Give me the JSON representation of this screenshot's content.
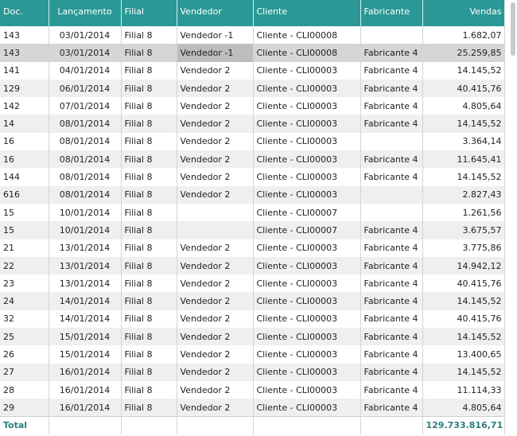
{
  "columns": {
    "doc": "Doc.",
    "lancamento": "Lançamento",
    "filial": "Filial",
    "vendedor": "Vendedor",
    "cliente": "Cliente",
    "fabricante": "Fabricante",
    "vendas": "Vendas"
  },
  "rows": [
    {
      "doc": "143",
      "lancamento": "03/01/2014",
      "filial": "Filial 8",
      "vendedor": "Vendedor -1",
      "cliente": "Cliente - CLI00008",
      "fabricante": "",
      "vendas": "1.682,07"
    },
    {
      "doc": "143",
      "lancamento": "03/01/2014",
      "filial": "Filial 8",
      "vendedor": "Vendedor -1",
      "cliente": "Cliente - CLI00008",
      "fabricante": "Fabricante 4",
      "vendas": "25.259,85"
    },
    {
      "doc": "141",
      "lancamento": "04/01/2014",
      "filial": "Filial 8",
      "vendedor": "Vendedor 2",
      "cliente": "Cliente - CLI00003",
      "fabricante": "Fabricante 4",
      "vendas": "14.145,52"
    },
    {
      "doc": "129",
      "lancamento": "06/01/2014",
      "filial": "Filial 8",
      "vendedor": "Vendedor 2",
      "cliente": "Cliente - CLI00003",
      "fabricante": "Fabricante 4",
      "vendas": "40.415,76"
    },
    {
      "doc": "142",
      "lancamento": "07/01/2014",
      "filial": "Filial 8",
      "vendedor": "Vendedor 2",
      "cliente": "Cliente - CLI00003",
      "fabricante": "Fabricante 4",
      "vendas": "4.805,64"
    },
    {
      "doc": "14",
      "lancamento": "08/01/2014",
      "filial": "Filial 8",
      "vendedor": "Vendedor 2",
      "cliente": "Cliente - CLI00003",
      "fabricante": "Fabricante 4",
      "vendas": "14.145,52"
    },
    {
      "doc": "16",
      "lancamento": "08/01/2014",
      "filial": "Filial 8",
      "vendedor": "Vendedor 2",
      "cliente": "Cliente - CLI00003",
      "fabricante": "",
      "vendas": "3.364,14"
    },
    {
      "doc": "16",
      "lancamento": "08/01/2014",
      "filial": "Filial 8",
      "vendedor": "Vendedor 2",
      "cliente": "Cliente - CLI00003",
      "fabricante": "Fabricante 4",
      "vendas": "11.645,41"
    },
    {
      "doc": "144",
      "lancamento": "08/01/2014",
      "filial": "Filial 8",
      "vendedor": "Vendedor 2",
      "cliente": "Cliente - CLI00003",
      "fabricante": "Fabricante 4",
      "vendas": "14.145,52"
    },
    {
      "doc": "616",
      "lancamento": "08/01/2014",
      "filial": "Filial 8",
      "vendedor": "Vendedor 2",
      "cliente": "Cliente - CLI00003",
      "fabricante": "",
      "vendas": "2.827,43"
    },
    {
      "doc": "15",
      "lancamento": "10/01/2014",
      "filial": "Filial 8",
      "vendedor": "",
      "cliente": "Cliente - CLI00007",
      "fabricante": "",
      "vendas": "1.261,56"
    },
    {
      "doc": "15",
      "lancamento": "10/01/2014",
      "filial": "Filial 8",
      "vendedor": "",
      "cliente": "Cliente - CLI00007",
      "fabricante": "Fabricante 4",
      "vendas": "3.675,57"
    },
    {
      "doc": "21",
      "lancamento": "13/01/2014",
      "filial": "Filial 8",
      "vendedor": "Vendedor 2",
      "cliente": "Cliente - CLI00003",
      "fabricante": "Fabricante 4",
      "vendas": "3.775,86"
    },
    {
      "doc": "22",
      "lancamento": "13/01/2014",
      "filial": "Filial 8",
      "vendedor": "Vendedor 2",
      "cliente": "Cliente - CLI00003",
      "fabricante": "Fabricante 4",
      "vendas": "14.942,12"
    },
    {
      "doc": "23",
      "lancamento": "13/01/2014",
      "filial": "Filial 8",
      "vendedor": "Vendedor 2",
      "cliente": "Cliente - CLI00003",
      "fabricante": "Fabricante 4",
      "vendas": "40.415,76"
    },
    {
      "doc": "24",
      "lancamento": "14/01/2014",
      "filial": "Filial 8",
      "vendedor": "Vendedor 2",
      "cliente": "Cliente - CLI00003",
      "fabricante": "Fabricante 4",
      "vendas": "14.145,52"
    },
    {
      "doc": "32",
      "lancamento": "14/01/2014",
      "filial": "Filial 8",
      "vendedor": "Vendedor 2",
      "cliente": "Cliente - CLI00003",
      "fabricante": "Fabricante 4",
      "vendas": "40.415,76"
    },
    {
      "doc": "25",
      "lancamento": "15/01/2014",
      "filial": "Filial 8",
      "vendedor": "Vendedor 2",
      "cliente": "Cliente - CLI00003",
      "fabricante": "Fabricante 4",
      "vendas": "14.145,52"
    },
    {
      "doc": "26",
      "lancamento": "15/01/2014",
      "filial": "Filial 8",
      "vendedor": "Vendedor 2",
      "cliente": "Cliente - CLI00003",
      "fabricante": "Fabricante 4",
      "vendas": "13.400,65"
    },
    {
      "doc": "27",
      "lancamento": "16/01/2014",
      "filial": "Filial 8",
      "vendedor": "Vendedor 2",
      "cliente": "Cliente - CLI00003",
      "fabricante": "Fabricante 4",
      "vendas": "14.145,52"
    },
    {
      "doc": "28",
      "lancamento": "16/01/2014",
      "filial": "Filial 8",
      "vendedor": "Vendedor 2",
      "cliente": "Cliente - CLI00003",
      "fabricante": "Fabricante 4",
      "vendas": "11.114,33"
    },
    {
      "doc": "29",
      "lancamento": "16/01/2014",
      "filial": "Filial 8",
      "vendedor": "Vendedor 2",
      "cliente": "Cliente - CLI00003",
      "fabricante": "Fabricante 4",
      "vendas": "4.805,64"
    }
  ],
  "footer": {
    "label": "Total",
    "vendas_total": "129.733.816,71"
  },
  "colors": {
    "header_bg": "#2a9896",
    "total_text": "#2a7e7c",
    "row_alt": "#efefef",
    "row_selected": "#d6d6d6"
  }
}
